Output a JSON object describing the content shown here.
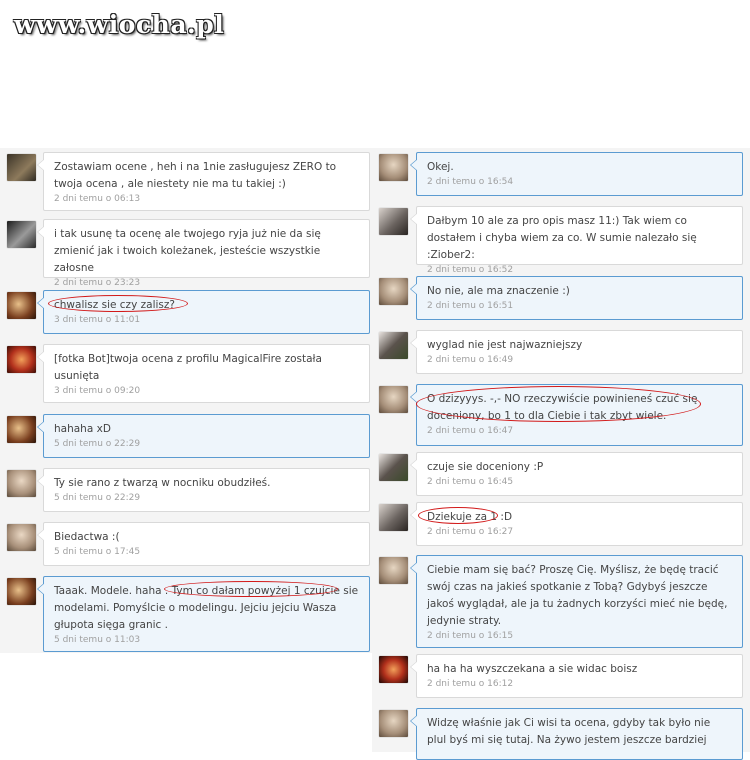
{
  "site": {
    "logo": "www.wiocha.pl"
  },
  "left_comments": [
    {
      "text": "Zostawiam ocene , heh i na 1nie zasługujesz ZERO to twoja ocena , ale niestety nie ma tu takiej :)",
      "time": "2 dni temu o 06:13"
    },
    {
      "text": "i tak usunę ta ocenę ale twojego ryja już nie da się zmienić jak i twoich koleżanek, jesteście wszystkie załosne",
      "time": "2 dni temu o 23:23"
    },
    {
      "text": "chwalisz sie czy zalisz?",
      "time": "3 dni temu o 11:01"
    },
    {
      "text": "[fotka Bot]twoja ocena z profilu MagicalFire została usunięta",
      "time": "3 dni temu o 09:20"
    },
    {
      "text": "hahaha xD",
      "time": "5 dni temu o 22:29"
    },
    {
      "text": "Ty sie rano z twarzą w nocniku obudziłeś.",
      "time": "5 dni temu o 22:29"
    },
    {
      "text": "Biedactwa :(",
      "time": "5 dni temu o 17:45"
    },
    {
      "text": "Taaak. Modele. haha . Tym co dałam powyżej 1 czujcie sie modelami. Pomyślcie o modelingu. Jejciu jejciu Wasza głupota sięga granic .",
      "time": "5 dni temu o 11:03"
    }
  ],
  "right_comments": [
    {
      "text": "Okej.",
      "time": "2 dni temu o 16:54"
    },
    {
      "text": "Dałbym 10 ale za pro opis masz 11:) Tak wiem co dostałem i chyba wiem za co. W sumie nalezało się :Ziober2:",
      "time": "2 dni temu o 16:52"
    },
    {
      "text": "No nie, ale ma znaczenie :)",
      "time": "2 dni temu o 16:51"
    },
    {
      "text": "wyglad nie jest najwazniejszy",
      "time": "2 dni temu o 16:49"
    },
    {
      "text": "O dzizyyys. -,- NO rzeczywiście powinieneś czuć się doceniony, bo 1 to dla Ciebie i tak zbyt wiele.",
      "time": "2 dni temu o 16:47"
    },
    {
      "text": "czuje sie doceniony :P",
      "time": "2 dni temu o 16:45"
    },
    {
      "text": "Dziekuje za 1 :D",
      "time": "2 dni temu o 16:27"
    },
    {
      "text": "Ciebie mam się bać? Proszę Cię. Myślisz, że będę tracić swój czas na jakieś spotkanie z Tobą? Gdybyś jeszcze jakoś wyglądał, ale ja tu żadnych korzyści mieć nie będę, jedynie straty.",
      "time": "2 dni temu o 16:15"
    },
    {
      "text": "ha ha ha wyszczekana a sie widac boisz",
      "time": "2 dni temu o 16:12"
    },
    {
      "text": "Widzę właśnie jak Ci wisi ta ocena, gdyby tak było nie plul byś mi się tutaj. Na żywo jestem jeszcze bardziej",
      "time": ""
    }
  ],
  "avatar_colors": {
    "blonde": "#c9b49a",
    "dark": "#5a4a3a",
    "red": "#b2301c",
    "male": "#6b6460",
    "grey": "#8a8a8a"
  }
}
